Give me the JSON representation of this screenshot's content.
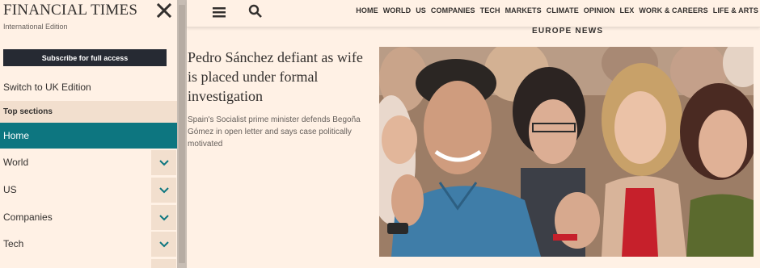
{
  "sidebar": {
    "brand": "FINANCIAL TIMES",
    "edition": "International Edition",
    "subscribe_label": "Subscribe for full access",
    "switch_edition": "Switch to UK Edition",
    "section_header": "Top sections",
    "items": [
      {
        "label": "Home",
        "active": true
      },
      {
        "label": "World"
      },
      {
        "label": "US"
      },
      {
        "label": "Companies"
      },
      {
        "label": "Tech"
      }
    ]
  },
  "topnav": [
    "HOME",
    "WORLD",
    "US",
    "COMPANIES",
    "TECH",
    "MARKETS",
    "CLIMATE",
    "OPINION",
    "LEX",
    "WORK & CAREERS",
    "LIFE & ARTS"
  ],
  "article": {
    "kicker": "EUROPE NEWS",
    "headline": "Pedro Sánchez defiant as wife is placed under formal investigation",
    "standfirst": "Spain's Socialist prime minister defends Begoña Gómez in open letter and says case politically motivated"
  },
  "icons": {
    "close": "close-icon",
    "menu": "menu-icon",
    "search": "search-icon",
    "chevron": "chevron-down-icon"
  },
  "colors": {
    "page_bg": "#fff1e5",
    "active_teal": "#0d7680",
    "subscribe_bg": "#262a33"
  }
}
